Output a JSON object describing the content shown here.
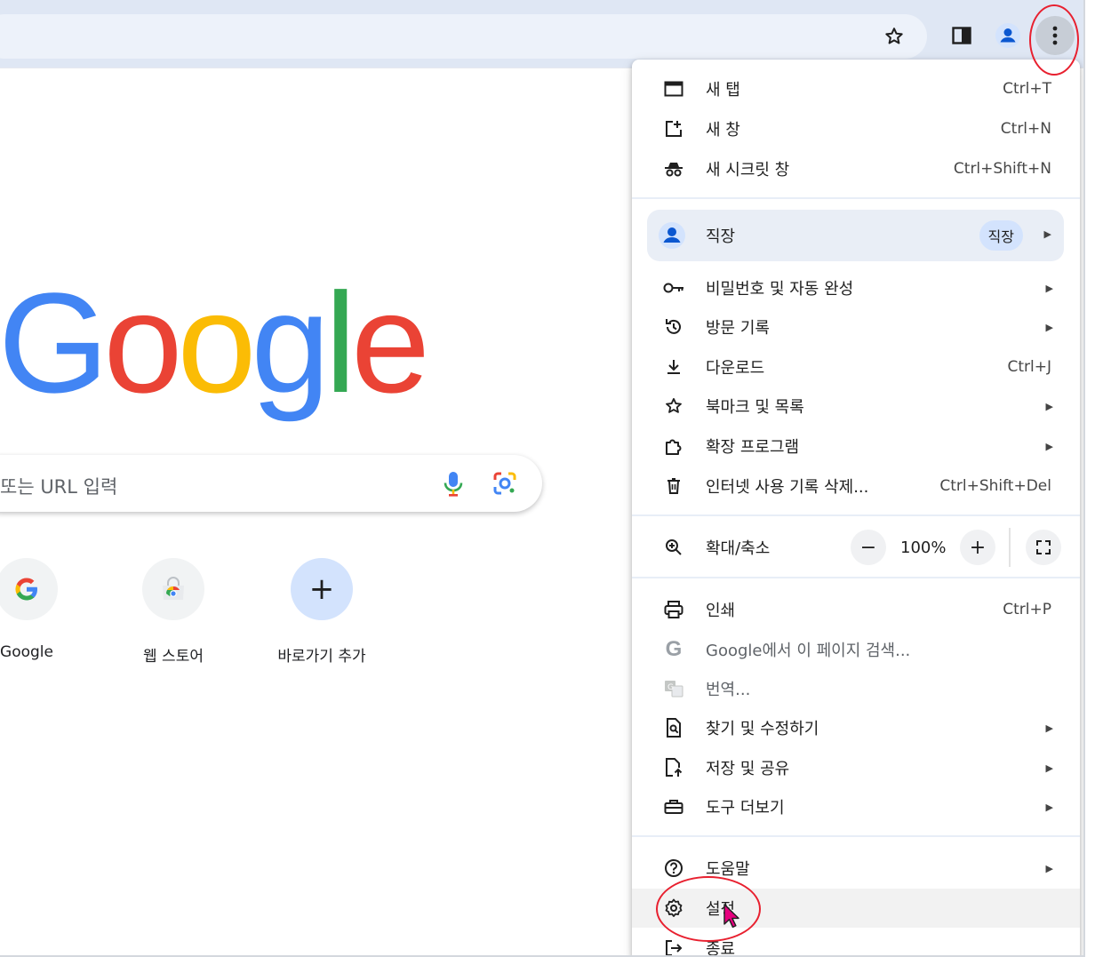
{
  "omnibox": {
    "bookmark_icon": "star-outline-icon"
  },
  "toolbar": {
    "side_panel_icon": "side-panel-icon",
    "profile_icon": "person-icon",
    "menu_icon": "more-vert-icon"
  },
  "logo": {
    "letters": [
      "G",
      "o",
      "o",
      "g",
      "l",
      "e"
    ],
    "colors": [
      "#4285F4",
      "#EA4335",
      "#FBBC05",
      "#4285F4",
      "#34A853",
      "#EA4335"
    ]
  },
  "search": {
    "placeholder": "또는 URL 입력"
  },
  "shortcuts": [
    {
      "label": "Google"
    },
    {
      "label": "웹 스토어"
    },
    {
      "label": "바로가기 추가",
      "glyph": "+"
    }
  ],
  "menu": {
    "new_tab": {
      "label": "새 탭",
      "shortcut": "Ctrl+T"
    },
    "new_window": {
      "label": "새 창",
      "shortcut": "Ctrl+N"
    },
    "incognito": {
      "label": "새 시크릿 창",
      "shortcut": "Ctrl+Shift+N"
    },
    "profile": {
      "label": "직장",
      "chip": "직장"
    },
    "passwords": {
      "label": "비밀번호 및 자동 완성"
    },
    "history": {
      "label": "방문 기록"
    },
    "downloads": {
      "label": "다운로드",
      "shortcut": "Ctrl+J"
    },
    "bookmarks": {
      "label": "북마크 및 목록"
    },
    "extensions": {
      "label": "확장 프로그램"
    },
    "clear_data": {
      "label": "인터넷 사용 기록 삭제...",
      "shortcut": "Ctrl+Shift+Del"
    },
    "zoom": {
      "label": "확대/축소",
      "minus": "−",
      "value": "100%",
      "plus": "+"
    },
    "print": {
      "label": "인쇄",
      "shortcut": "Ctrl+P"
    },
    "search_page": {
      "label": "Google에서 이 페이지 검색..."
    },
    "translate": {
      "label": "번역..."
    },
    "find_edit": {
      "label": "찾기 및 수정하기"
    },
    "save_share": {
      "label": "저장 및 공유"
    },
    "more_tools": {
      "label": "도구 더보기"
    },
    "help": {
      "label": "도움말"
    },
    "settings": {
      "label": "설정"
    },
    "exit": {
      "label": "종료"
    }
  },
  "annotation_color": "#e8202f"
}
